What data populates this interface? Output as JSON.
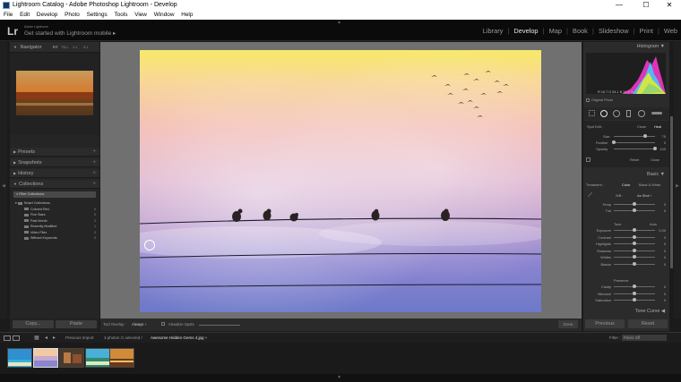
{
  "window": {
    "title": "Lightroom Catalog - Adobe Photoshop Lightroom - Develop",
    "controls": {
      "minimize": "—",
      "maximize": "☐",
      "close": "✕"
    }
  },
  "menubar": [
    "File",
    "Edit",
    "Develop",
    "Photo",
    "Settings",
    "Tools",
    "View",
    "Window",
    "Help"
  ],
  "identity": {
    "logo": "Lr",
    "small_text": "Adobe Lightroom",
    "main_text": "Get started with Lightroom mobile ▸"
  },
  "modules": [
    "Library",
    "Develop",
    "Map",
    "Book",
    "Slideshow",
    "Print",
    "Web"
  ],
  "left_panel": {
    "navigator": {
      "title": "Navigator",
      "zoom_options": [
        "FIT",
        "FILL",
        "1:1",
        "3:1"
      ]
    },
    "sections": [
      "Presets",
      "Snapshots",
      "History",
      "Collections"
    ],
    "collections": {
      "filter_label": "Filter Collections",
      "group": "Smart Collections",
      "items": [
        {
          "name": "Colored Red",
          "count": "0"
        },
        {
          "name": "Five Stars",
          "count": "0"
        },
        {
          "name": "Past Month",
          "count": "3"
        },
        {
          "name": "Recently Modified",
          "count": "1"
        },
        {
          "name": "Video Files",
          "count": "0"
        },
        {
          "name": "Without Keywords",
          "count": "3"
        }
      ]
    },
    "copy_label": "Copy...",
    "paste_label": "Paste"
  },
  "toolbar": {
    "tool_overlay_label": "Tool Overlay :",
    "tool_overlay_value": "Always ÷",
    "visualize_spots": "Visualize Spots",
    "done_label": "Done"
  },
  "right_panel": {
    "histogram": {
      "title": "Histogram",
      "readout": "R 16.7  G 54.1  B 16.4 %",
      "original_photo": "Original Photo"
    },
    "spot": {
      "mode_label": "Spot Edit :",
      "modes": [
        "Clone",
        "Heal"
      ],
      "size_label": "Size",
      "size_value": "75",
      "size_level": 0.75,
      "feather_label": "Feather",
      "feather_value": "0",
      "feather_level": 0.0,
      "opacity_label": "Opacity",
      "opacity_value": "100",
      "opacity_level": 1.0,
      "reset_label": "Reset",
      "close_label": "Close"
    },
    "basic": {
      "title": "Basic",
      "treatment_label": "Treatment :",
      "treatment_options": [
        "Color",
        "Black & White"
      ],
      "wb_label": "WB :",
      "wb_value": "As Shot ÷",
      "sliders_wb": [
        {
          "label": "Temp",
          "value": "0",
          "level": 0.5
        },
        {
          "label": "Tint",
          "value": "0",
          "level": 0.5
        }
      ],
      "tone_label": "Tone",
      "auto_label": "Auto",
      "sliders_tone": [
        {
          "label": "Exposure",
          "value": "0.00",
          "level": 0.5
        },
        {
          "label": "Contrast",
          "value": "0",
          "level": 0.5
        },
        {
          "label": "Highlights",
          "value": "0",
          "level": 0.5
        },
        {
          "label": "Shadows",
          "value": "0",
          "level": 0.5
        },
        {
          "label": "Whites",
          "value": "0",
          "level": 0.5
        },
        {
          "label": "Blacks",
          "value": "0",
          "level": 0.5
        }
      ],
      "presence_label": "Presence",
      "sliders_presence": [
        {
          "label": "Clarity",
          "value": "0",
          "level": 0.5
        },
        {
          "label": "Vibrance",
          "value": "0",
          "level": 0.5
        },
        {
          "label": "Saturation",
          "value": "0",
          "level": 0.5
        }
      ]
    },
    "tone_curve": "Tone Curve",
    "previous_label": "Previous",
    "reset_label": "Reset"
  },
  "filmbar": {
    "source_label": "Previous Import",
    "info": "3 photos /1 selected /",
    "filename": "Awesome Hidden Gems 4.jpg ÷",
    "filter_label": "Filter :",
    "filter_value": "Filters Off"
  },
  "colors": {
    "accent_active_module": "#e6e6e6",
    "panel_bg": "#2b2b2b",
    "canvas_bg": "#707070"
  }
}
